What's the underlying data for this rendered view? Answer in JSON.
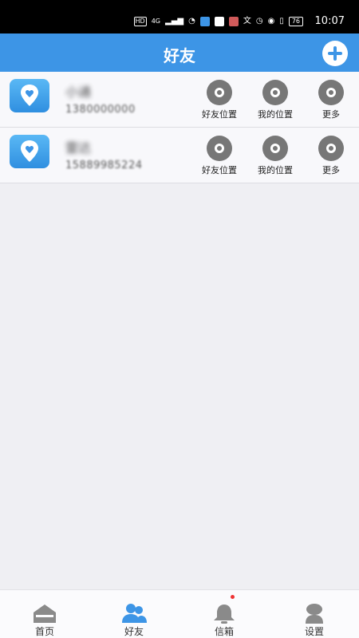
{
  "status_bar": {
    "time": "10:07",
    "battery": "76",
    "indicators": [
      "HD",
      "4G",
      "signal-icon",
      "wifi-icon",
      "shield-app-icon",
      "info-app-icon",
      "bag-app-icon",
      "translate-icon",
      "alarm-icon",
      "location-icon",
      "vibrate-icon"
    ]
  },
  "header": {
    "title": "好友"
  },
  "friends": [
    {
      "name": "小通",
      "phone": "1380000000",
      "actions": {
        "friend_location": "好友位置",
        "my_location": "我的位置",
        "more": "更多"
      }
    },
    {
      "name": "雷达",
      "phone": "15889985224",
      "actions": {
        "friend_location": "好友位置",
        "my_location": "我的位置",
        "more": "更多"
      }
    }
  ],
  "bottom_nav": {
    "home": "首页",
    "friends": "好友",
    "inbox": "信箱",
    "settings": "设置"
  },
  "colors": {
    "accent": "#3d95e6",
    "action_icon": "#777777",
    "nav_inactive": "#8a8a8a",
    "nav_active": "#3d95e6",
    "badge": "#ee3333"
  }
}
